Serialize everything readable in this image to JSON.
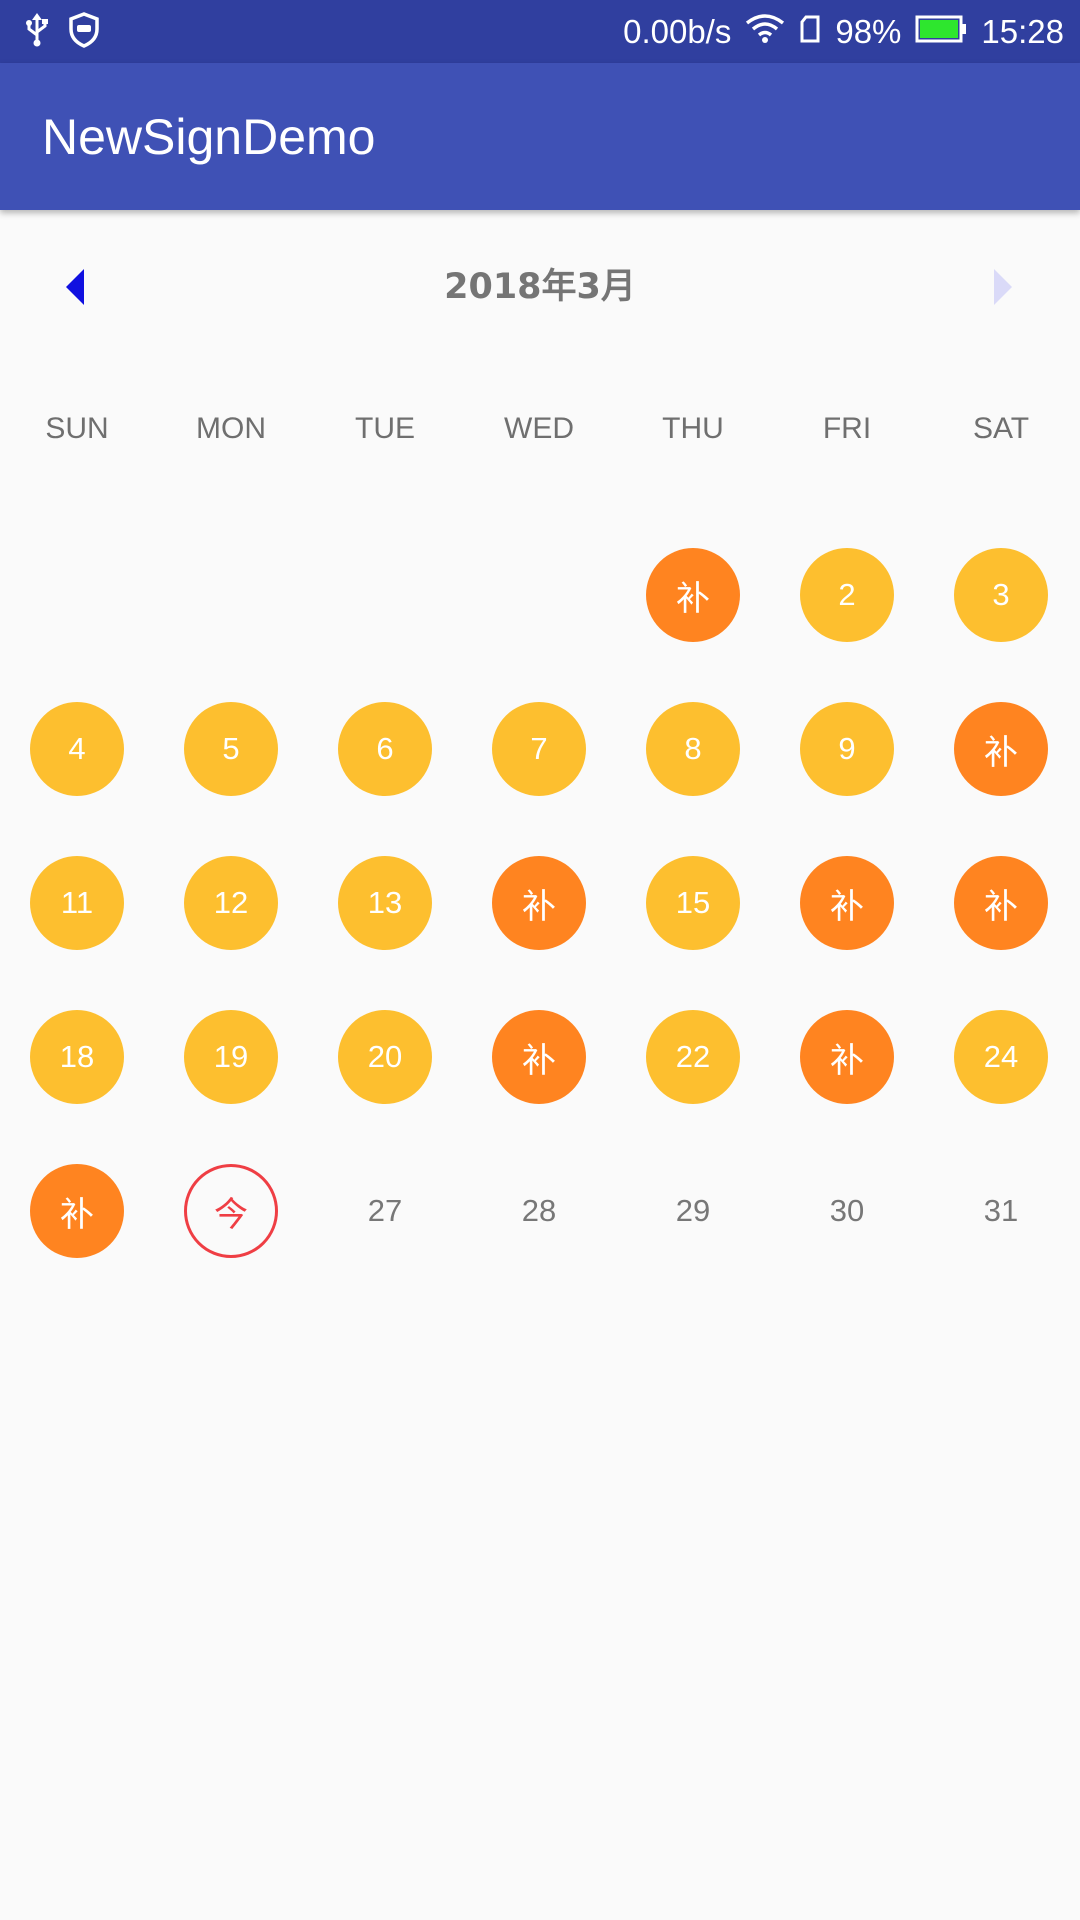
{
  "status_bar": {
    "net_speed": "0.00b/s",
    "battery": "98%",
    "time": "15:28",
    "icons": [
      "usb-icon",
      "shield-icon",
      "wifi-icon",
      "sim-icon",
      "battery-icon"
    ]
  },
  "app_bar": {
    "title": "NewSignDemo"
  },
  "calendar": {
    "month_title": "2018年3月",
    "weekdays": [
      "SUN",
      "MON",
      "TUE",
      "WED",
      "THU",
      "FRI",
      "SAT"
    ],
    "leading_blanks": 4,
    "days": [
      {
        "label": "补",
        "state": "makeup"
      },
      {
        "label": "2",
        "state": "signed"
      },
      {
        "label": "3",
        "state": "signed"
      },
      {
        "label": "4",
        "state": "signed"
      },
      {
        "label": "5",
        "state": "signed"
      },
      {
        "label": "6",
        "state": "signed"
      },
      {
        "label": "7",
        "state": "signed"
      },
      {
        "label": "8",
        "state": "signed"
      },
      {
        "label": "9",
        "state": "signed"
      },
      {
        "label": "补",
        "state": "makeup"
      },
      {
        "label": "11",
        "state": "signed"
      },
      {
        "label": "12",
        "state": "signed"
      },
      {
        "label": "13",
        "state": "signed"
      },
      {
        "label": "补",
        "state": "makeup"
      },
      {
        "label": "15",
        "state": "signed"
      },
      {
        "label": "补",
        "state": "makeup"
      },
      {
        "label": "补",
        "state": "makeup"
      },
      {
        "label": "18",
        "state": "signed"
      },
      {
        "label": "19",
        "state": "signed"
      },
      {
        "label": "20",
        "state": "signed"
      },
      {
        "label": "补",
        "state": "makeup"
      },
      {
        "label": "22",
        "state": "signed"
      },
      {
        "label": "补",
        "state": "makeup"
      },
      {
        "label": "24",
        "state": "signed"
      },
      {
        "label": "补",
        "state": "makeup"
      },
      {
        "label": "今",
        "state": "today"
      },
      {
        "label": "27",
        "state": "plain"
      },
      {
        "label": "28",
        "state": "plain"
      },
      {
        "label": "29",
        "state": "plain"
      },
      {
        "label": "30",
        "state": "plain"
      },
      {
        "label": "31",
        "state": "plain"
      }
    ]
  },
  "colors": {
    "status_bar": "#303f9f",
    "app_bar": "#3f51b5",
    "signed": "#fdbf2f",
    "makeup": "#ff8420",
    "today": "#ef3e44",
    "prev_arrow": "#1010e0",
    "next_arrow": "#dadaf8"
  }
}
